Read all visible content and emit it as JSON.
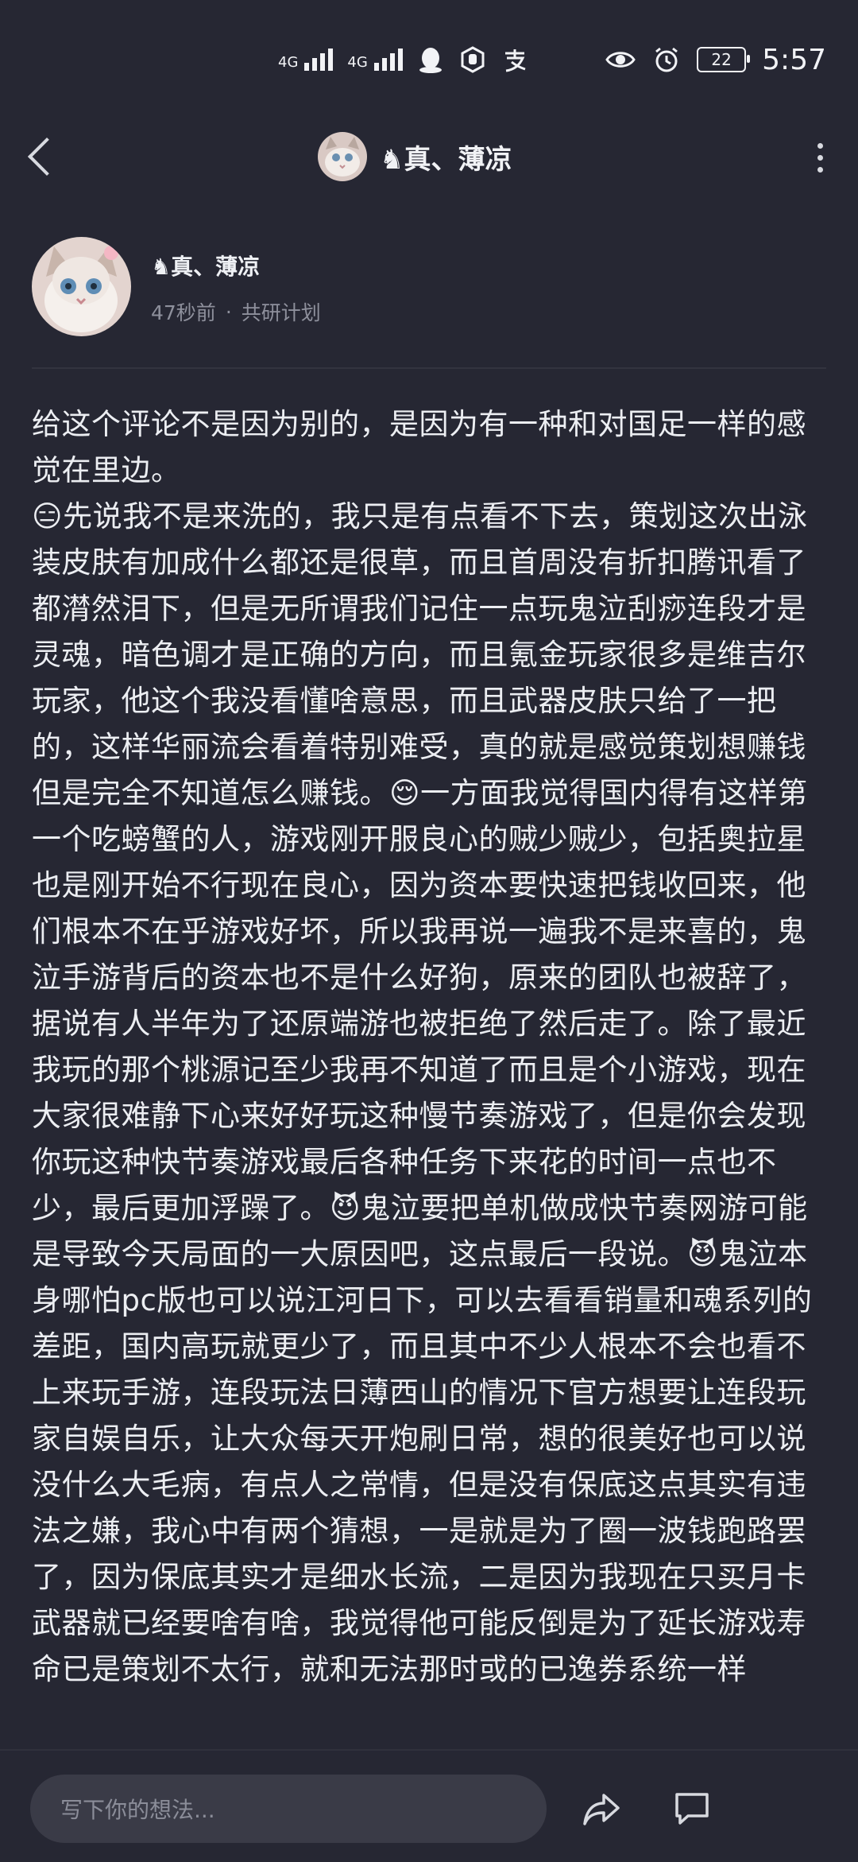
{
  "status": {
    "time": "5:57",
    "battery": "22",
    "network1": "4G",
    "network2": "4G",
    "colors": {
      "icon": "#f2f3f6"
    }
  },
  "header": {
    "title": "♞真、薄凉"
  },
  "post": {
    "author": "♞真、薄凉",
    "time_ago": "47秒前",
    "separator": "·",
    "group": "共研计划",
    "body": "给这个评论不是因为别的，是因为有一种和对国足一样的感觉在里边。\n😑先说我不是来洗的，我只是有点看不下去，策划这次出泳装皮肤有加成什么都还是很草，而且首周没有折扣腾讯看了都潸然泪下，但是无所谓我们记住一点玩鬼泣刮痧连段才是灵魂，暗色调才是正确的方向，而且氪金玩家很多是维吉尔玩家，他这个我没看懂啥意思，而且武器皮肤只给了一把的，这样华丽流会看着特别难受，真的就是感觉策划想赚钱但是完全不知道怎么赚钱。😌一方面我觉得国内得有这样第一个吃螃蟹的人，游戏刚开服良心的贼少贼少，包括奥拉星也是刚开始不行现在良心，因为资本要快速把钱收回来，他们根本不在乎游戏好坏，所以我再说一遍我不是来喜的，鬼泣手游背后的资本也不是什么好狗，原来的团队也被辞了，据说有人半年为了还原端游也被拒绝了然后走了。除了最近我玩的那个桃源记至少我再不知道了而且是个小游戏，现在大家很难静下心来好好玩这种慢节奏游戏了，但是你会发现你玩这种快节奏游戏最后各种任务下来花的时间一点也不少，最后更加浮躁了。😈鬼泣要把单机做成快节奏网游可能是导致今天局面的一大原因吧，这点最后一段说。😈鬼泣本身哪怕pc版也可以说江河日下，可以去看看销量和魂系列的差距，国内高玩就更少了，而且其中不少人根本不会也看不上来玩手游，连段玩法日薄西山的情况下官方想要让连段玩家自娱自乐，让大众每天开炮刷日常，想的很美好也可以说没什么大毛病，有点人之常情，但是没有保底这点其实有违法之嫌，我心中有两个猜想，一是就是为了圈一波钱跑路罢了，因为保底其实才是细水长流，二是因为我现在只买月卡武器就已经要啥有啥，我觉得他可能反倒是为了延长游戏寿命已是策划不太行，就和无法那时或的已逸券系统一样"
  },
  "composer": {
    "placeholder": "写下你的想法..."
  }
}
